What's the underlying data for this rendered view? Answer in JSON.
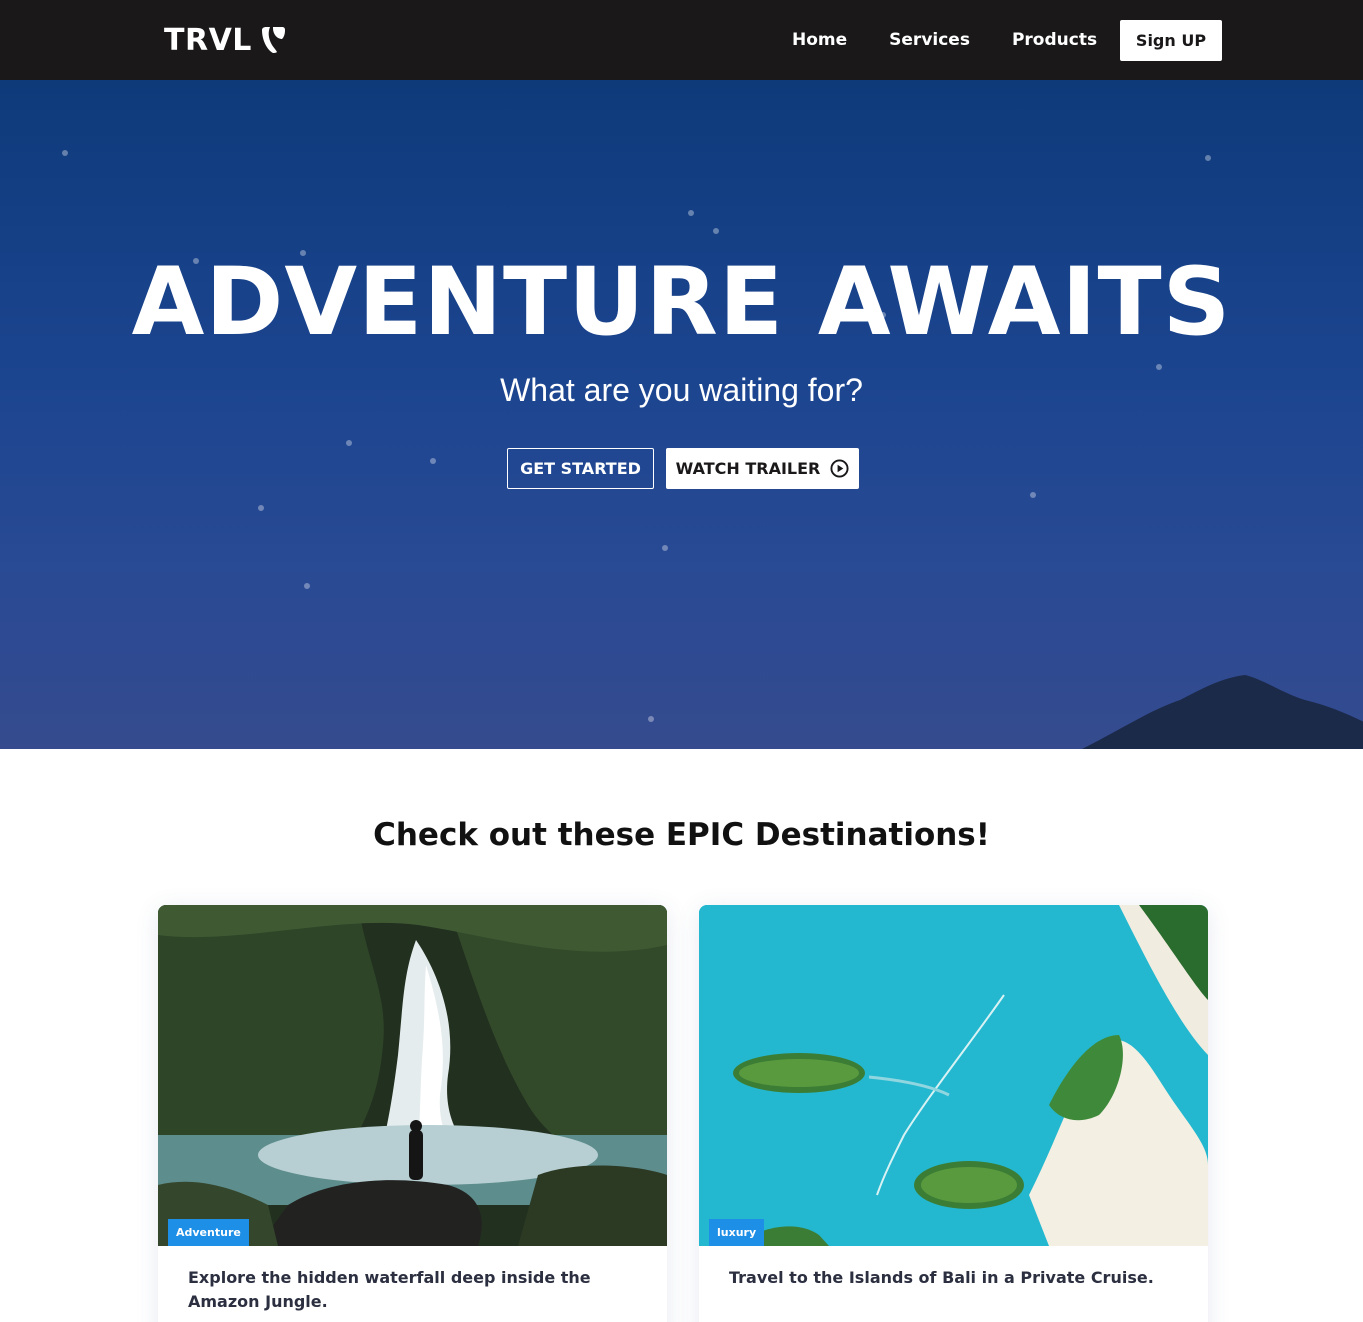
{
  "navbar": {
    "logo_text": "TRVL",
    "logo_icon": "typo3-logo-icon",
    "links": [
      {
        "label": "Home"
      },
      {
        "label": "Services"
      },
      {
        "label": "Products"
      }
    ],
    "signup_label": "Sign UP"
  },
  "hero": {
    "title": "ADVENTURE AWAITS",
    "subtitle": "What are you waiting for?",
    "get_started_label": "GET STARTED",
    "watch_trailer_label": "WATCH TRAILER",
    "watch_trailer_icon": "play-circle-icon"
  },
  "destinations": {
    "title": "Check out these EPIC Destinations!",
    "cards": [
      {
        "tag": "Adventure",
        "text": "Explore the hidden waterfall deep inside the Amazon Jungle."
      },
      {
        "tag": "luxury",
        "text": "Travel to the Islands of Bali in a Private Cruise."
      }
    ]
  },
  "colors": {
    "navbar_bg": "#1a1818",
    "hero_bg": "#1c4590",
    "tag_bg": "#1e8fe6",
    "card_text": "#2b2f40"
  }
}
